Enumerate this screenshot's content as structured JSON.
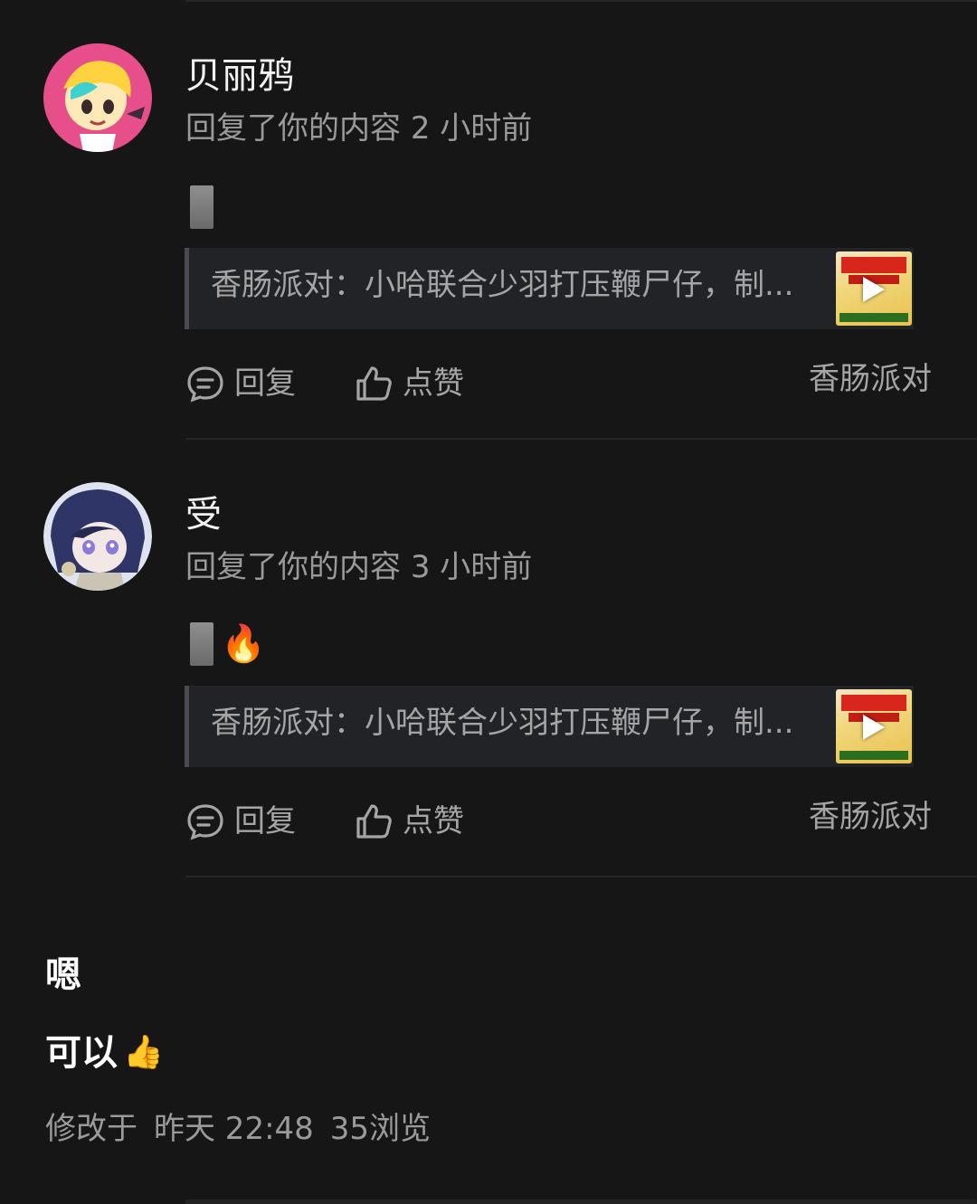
{
  "notifications": [
    {
      "user_name": "贝丽鸦",
      "action_text": "回复了你的内容",
      "time_ago": "2 小时前",
      "reply_emoji": "",
      "quoted_text": "香肠派对：小哈联合少羽打压鞭尸仔，制...",
      "reply_label": "回复",
      "like_label": "点赞",
      "topic_label": "香肠派对"
    },
    {
      "user_name": "受",
      "action_text": "回复了你的内容",
      "time_ago": "3 小时前",
      "reply_emoji": "🔥",
      "quoted_text": "香肠派对：小哈联合少羽打压鞭尸仔，制...",
      "reply_label": "回复",
      "like_label": "点赞",
      "topic_label": "香肠派对"
    }
  ],
  "post": {
    "line1": "嗯",
    "line2": "可以",
    "line2_emoji": "👍",
    "modified_label": "修改于",
    "modified_time": "昨天 22:48",
    "views": "35浏览"
  },
  "colors": {
    "background": "#161616",
    "avatar1_bg": "#e64f8a",
    "avatar2_bg": "#2f3a66"
  },
  "icons": [
    "comment-icon",
    "thumbs-up-icon",
    "play-icon"
  ]
}
